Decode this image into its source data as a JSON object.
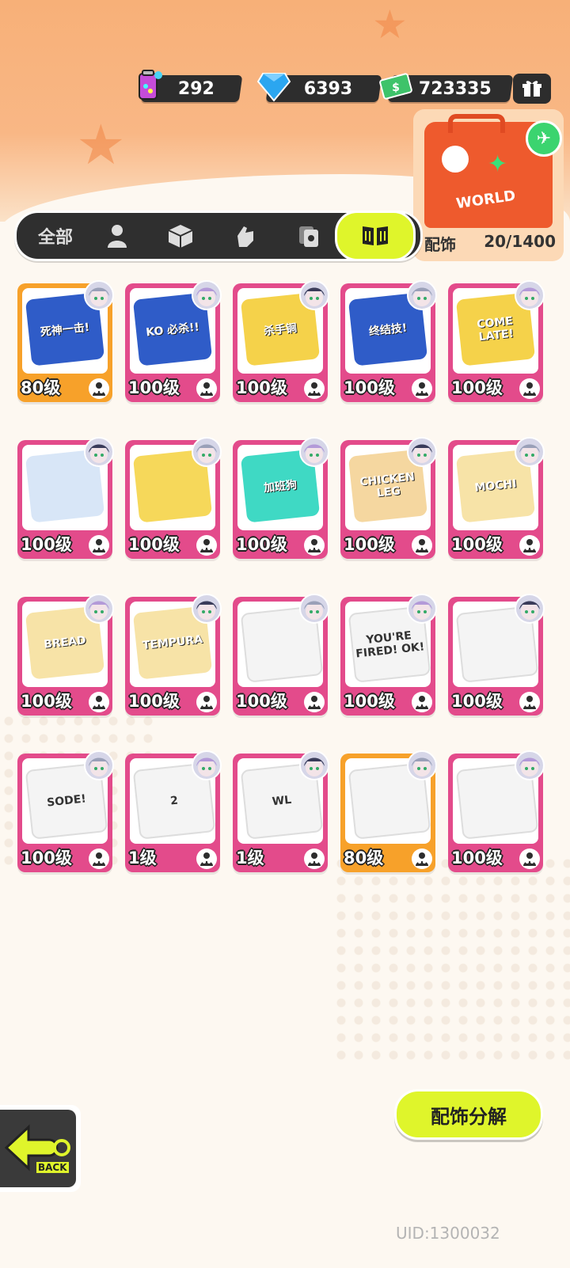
{
  "currency": {
    "paint": "292",
    "diamonds": "6393",
    "cash": "723335"
  },
  "suitcase": {
    "brand": "WORLD",
    "label": "配饰",
    "count": "20/1400"
  },
  "tabs": [
    {
      "label": "全部",
      "icon": "all"
    },
    {
      "label": "",
      "icon": "person-icon"
    },
    {
      "label": "",
      "icon": "box-icon"
    },
    {
      "label": "",
      "icon": "hand-icon"
    },
    {
      "label": "",
      "icon": "card-icon"
    },
    {
      "label": "",
      "icon": "book-icon",
      "active": true
    }
  ],
  "items": [
    {
      "level": "80级",
      "rarity": "gold",
      "art_text": "死神一击!",
      "art_bg": "#2f5cc8"
    },
    {
      "level": "100级",
      "rarity": "pink",
      "art_text": "KO 必杀!!",
      "art_bg": "#2f5cc8"
    },
    {
      "level": "100级",
      "rarity": "pink",
      "art_text": "杀手锏",
      "art_bg": "#f5d24a"
    },
    {
      "level": "100级",
      "rarity": "pink",
      "art_text": "终结技!",
      "art_bg": "#2f5cc8"
    },
    {
      "level": "100级",
      "rarity": "pink",
      "art_text": "COME LATE!",
      "art_bg": "#f5d24a"
    },
    {
      "level": "100级",
      "rarity": "pink",
      "art_text": "",
      "art_bg": "#d8e6f7"
    },
    {
      "level": "100级",
      "rarity": "pink",
      "art_text": "",
      "art_bg": "#f6d85a"
    },
    {
      "level": "100级",
      "rarity": "pink",
      "art_text": "加班狗",
      "art_bg": "#3fd9c4"
    },
    {
      "level": "100级",
      "rarity": "pink",
      "art_text": "CHICKEN LEG",
      "art_bg": "#f5d7a0"
    },
    {
      "level": "100级",
      "rarity": "pink",
      "art_text": "MOCHI",
      "art_bg": "#f7e3a7"
    },
    {
      "level": "100级",
      "rarity": "pink",
      "art_text": "BREAD",
      "art_bg": "#f7e3a7"
    },
    {
      "level": "100级",
      "rarity": "pink",
      "art_text": "TEMPURA",
      "art_bg": "#f7e3a7"
    },
    {
      "level": "100级",
      "rarity": "pink",
      "art_text": "",
      "art_bg": "#ffffff"
    },
    {
      "level": "100级",
      "rarity": "pink",
      "art_text": "YOU'RE FIRED! OK!",
      "art_bg": "#ffffff"
    },
    {
      "level": "100级",
      "rarity": "pink",
      "art_text": "",
      "art_bg": "#ffffff"
    },
    {
      "level": "100级",
      "rarity": "pink",
      "art_text": "SODE!",
      "art_bg": "#ffffff"
    },
    {
      "level": "1级",
      "rarity": "pink",
      "art_text": "2",
      "art_bg": "#ffffff"
    },
    {
      "level": "1级",
      "rarity": "pink",
      "art_text": "WL",
      "art_bg": "#ffffff"
    },
    {
      "level": "80级",
      "rarity": "gold",
      "art_text": "",
      "art_bg": "#ffffff"
    },
    {
      "level": "100级",
      "rarity": "pink",
      "art_text": "",
      "art_bg": "#ffffff"
    }
  ],
  "decompose_button": "配饰分解",
  "back_label": "BACK",
  "uid": "UID:1300032",
  "colors": {
    "accent": "#dff52b",
    "pink": "#e34b8b",
    "gold": "#f7a12a",
    "dark": "#2f2f2f"
  }
}
